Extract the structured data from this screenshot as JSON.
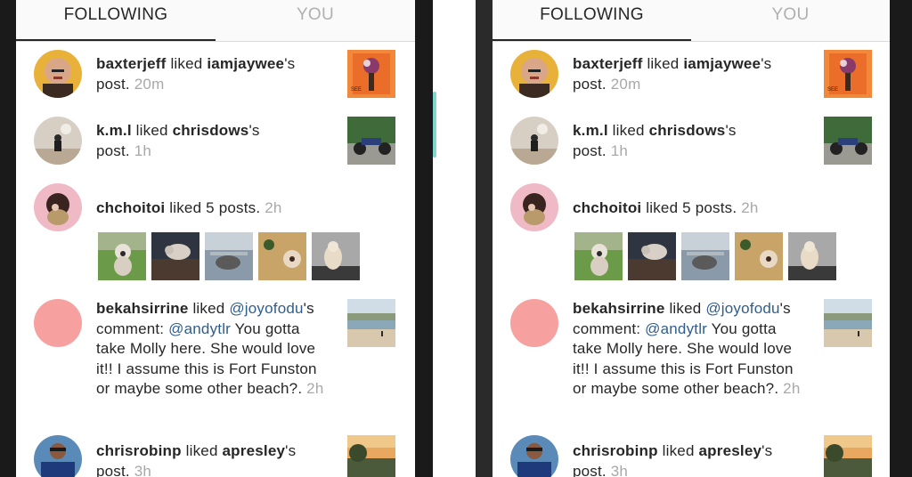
{
  "tabs": {
    "following": "FOLLOWING",
    "you": "YOU"
  },
  "feed": [
    {
      "user": "baxterjeff",
      "action": " liked ",
      "target": "iamjaywee",
      "suffix": "'s",
      "line2": "post. ",
      "time": "20m"
    },
    {
      "user": "k.m.l",
      "action": " liked ",
      "target": "chrisdows",
      "suffix": "'s",
      "line2": "post. ",
      "time": "1h"
    },
    {
      "user": "chchoitoi",
      "action": " liked 5 posts. ",
      "time": "2h"
    },
    {
      "user": "bekahsirrine",
      "action": " liked ",
      "mention1": "@joyofodu",
      "suffix": "'s",
      "l2a": "comment: ",
      "mention2": "@andytlr",
      "l2b": " You gotta",
      "l3": "take Molly here. She would love",
      "l4": "it!! I assume this is Fort Funston",
      "l5": "or maybe some other beach?. ",
      "time": "2h"
    },
    {
      "user": "chrisrobinp",
      "action": " liked ",
      "target": "apresley",
      "suffix": "'s",
      "line2": "post. ",
      "time": "3h"
    }
  ],
  "colors": {
    "bezel": "#1a1a1a",
    "accent": "#7fd6cc",
    "mention": "#2f5e8c",
    "timestamp": "#a8a8a8",
    "text": "#262626",
    "placeholder_avatar": "#f7a0a0"
  },
  "icons": [
    "avatar-baxterjeff",
    "avatar-kml",
    "avatar-chchoitoi",
    "avatar-bekahsirrine",
    "avatar-chrisrobinp",
    "thumb-flowers",
    "thumb-motorcycle",
    "thumb-dog-1",
    "thumb-dog-2",
    "thumb-dog-3",
    "thumb-dog-4",
    "thumb-dog-5",
    "thumb-beach",
    "thumb-sunset"
  ]
}
